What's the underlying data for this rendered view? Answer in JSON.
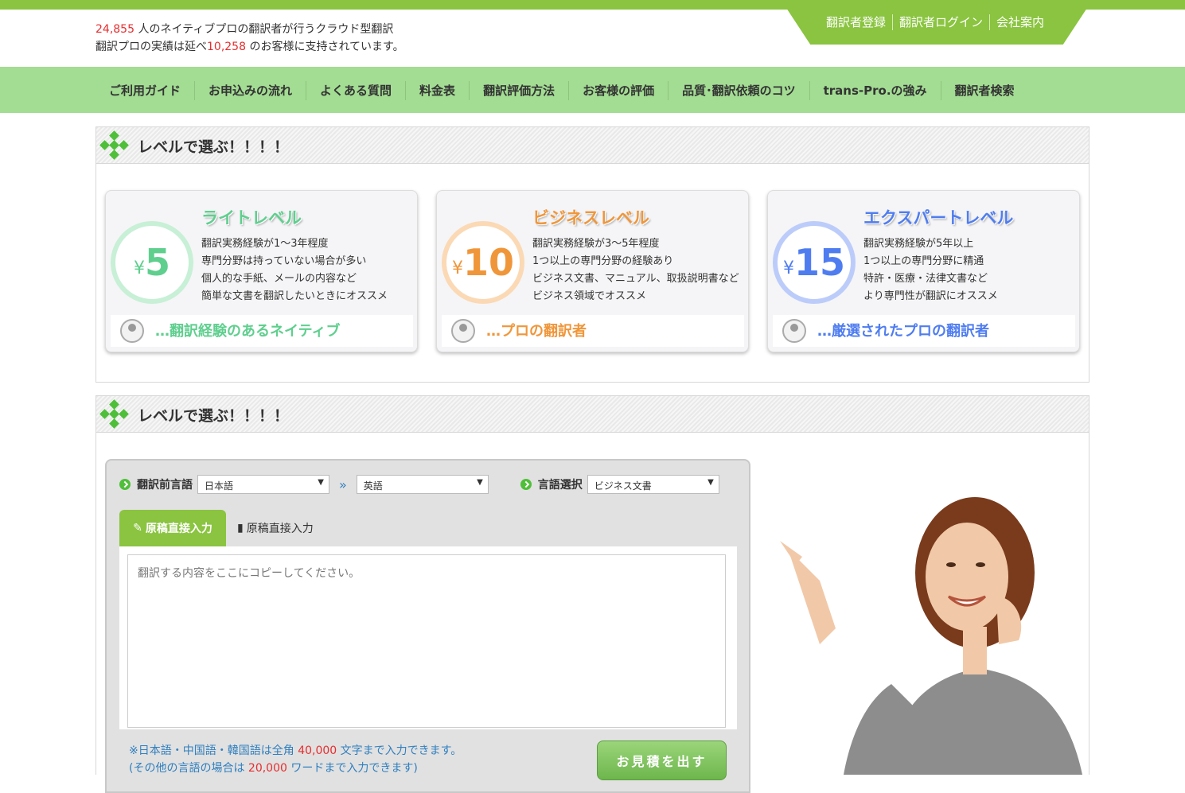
{
  "header": {
    "stats_line1_num": "24,855",
    "stats_line1_text": " 人のネイティブプロの翻訳者が行うクラウド型翻訳",
    "stats_line2_pre": "翻訳プロの実績は延べ",
    "stats_line2_num": "10,258",
    "stats_line2_post": " のお客様に支持されています。",
    "links": [
      "翻訳者登録",
      "翻訳者ログイン",
      "会社案内"
    ]
  },
  "nav": {
    "items": [
      "ご利用ガイド",
      "お申込みの流れ",
      "よくある質問",
      "料金表",
      "翻訳評価方法",
      "お客様の評価",
      "品質･翻訳依頼のコツ",
      "trans-Pro.の強み",
      "翻訳者検索"
    ]
  },
  "section1": {
    "title": "レベルで選ぶ！！！！",
    "cards": [
      {
        "yen": "¥",
        "price": "5",
        "title": "ライトレベル",
        "color": "#5fcf8e",
        "ring": "#c7f0d6",
        "lines": [
          "翻訳実務経験が1～3年程度",
          "専門分野は持っていない場合が多い",
          "個人的な手紙、メールの内容など",
          "簡単な文書を翻訳したいときにオススメ"
        ],
        "tag": "…翻訳経験のあるネイティブ"
      },
      {
        "yen": "¥",
        "price": "10",
        "title": "ビジネスレベル",
        "color": "#f0963a",
        "ring": "#fbd9b5",
        "lines": [
          "翻訳実務経験が3～5年程度",
          "1つ以上の専門分野の経験あり",
          "ビジネス文書、マニュアル、取扱説明書など",
          "ビジネス領域でオススメ"
        ],
        "tag": "…プロの翻訳者"
      },
      {
        "yen": "¥",
        "price": "15",
        "title": "エクスパートレベル",
        "color": "#4f7df0",
        "ring": "#bcccfa",
        "lines": [
          "翻訳実務経験が5年以上",
          "1つ以上の専門分野に精通",
          "特許・医療・法律文書など",
          "より専門性が翻訳にオススメ"
        ],
        "tag": "…厳選されたプロの翻訳者"
      }
    ]
  },
  "section2": {
    "title": "レベルで選ぶ！！！！",
    "source_label": "翻訳前言語",
    "source_value": "日本語",
    "arrow": "»",
    "target_value": "英語",
    "category_label": "言語選択",
    "category_value": "ビジネス文書",
    "tab_active": "原稿直接入力",
    "tab_other": "原稿直接入力",
    "textarea_placeholder": "翻訳する内容をここにコピーしてください。",
    "note1_pre": "※日本語・中国語・韓国語は全角 ",
    "note1_num": "40,000",
    "note1_post": " 文字まで入力できます。",
    "note2_pre": "(その他の言語の場合は ",
    "note2_num": "20,000",
    "note2_post": " ワードまで入力できます)",
    "quote_button": "お見積を出す"
  }
}
